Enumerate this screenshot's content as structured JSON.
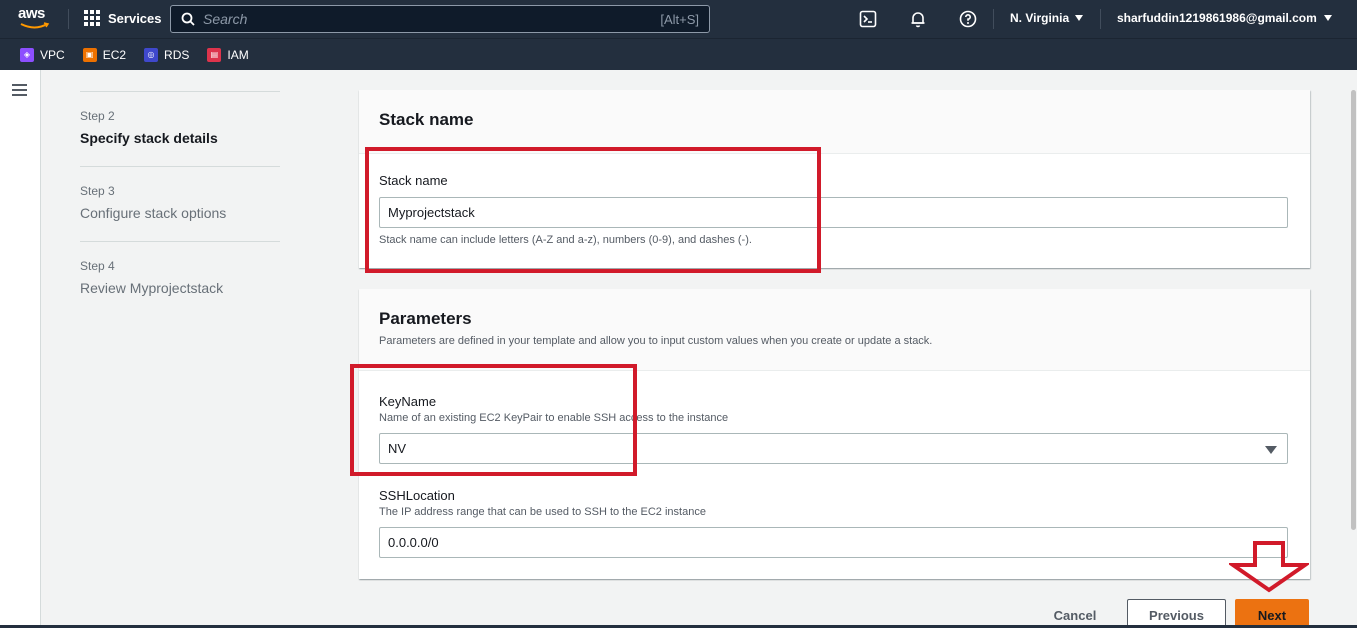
{
  "nav": {
    "logo": "aws",
    "services": "Services",
    "search_placeholder": "Search",
    "search_shortcut": "[Alt+S]",
    "region": "N. Virginia",
    "account": "sharfuddin1219861986@gmail.com"
  },
  "favorites": [
    {
      "label": "VPC",
      "color": "#8c4fff"
    },
    {
      "label": "EC2",
      "color": "#ed7100"
    },
    {
      "label": "RDS",
      "color": "#3f48cc"
    },
    {
      "label": "IAM",
      "color": "#dd344c"
    }
  ],
  "steps": [
    {
      "num": "Step 2",
      "title": "Specify stack details",
      "active": true
    },
    {
      "num": "Step 3",
      "title": "Configure stack options",
      "active": false
    },
    {
      "num": "Step 4",
      "title": "Review Myprojectstack",
      "active": false
    }
  ],
  "stack_name": {
    "header": "Stack name",
    "label": "Stack name",
    "value": "Myprojectstack",
    "hint": "Stack name can include letters (A-Z and a-z), numbers (0-9), and dashes (-)."
  },
  "parameters": {
    "header": "Parameters",
    "description": "Parameters are defined in your template and allow you to input custom values when you create or update a stack.",
    "keyname": {
      "label": "KeyName",
      "description": "Name of an existing EC2 KeyPair to enable SSH access to the instance",
      "value": "NV"
    },
    "sshlocation": {
      "label": "SSHLocation",
      "description": "The IP address range that can be used to SSH to the EC2 instance",
      "value": "0.0.0.0/0"
    }
  },
  "buttons": {
    "cancel": "Cancel",
    "previous": "Previous",
    "next": "Next"
  },
  "colors": {
    "nav_bg": "#232f3e",
    "primary": "#ec7211",
    "annotation": "#d11a2a"
  }
}
